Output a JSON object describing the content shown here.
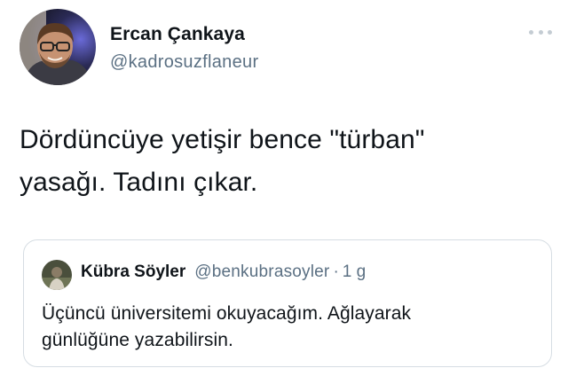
{
  "tweet": {
    "author": {
      "name": "Ercan Çankaya",
      "handle": "@kadrosuzflaneur"
    },
    "text_lines": [
      "Dördüncüye yetişir bence \"türban\"",
      "yasağı. Tadını çıkar."
    ],
    "menu_icon": "more-horizontal-icon"
  },
  "quoted_tweet": {
    "author": {
      "name": "Kübra Söyler",
      "handle": "@benkubrasoyler"
    },
    "separator": "·",
    "time": "1 g",
    "text_lines": [
      "Üçüncü üniversitemi okuyacağım. Ağlayarak",
      "günlüğüne yazabilirsin."
    ]
  },
  "colors": {
    "text_primary": "#0f1419",
    "text_secondary": "#5b7083",
    "border": "#d6dde3"
  }
}
